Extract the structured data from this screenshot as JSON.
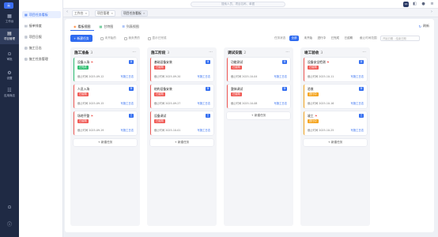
{
  "rail": {
    "logo": "云",
    "items": [
      {
        "icon": "▦",
        "label": "工作台"
      },
      {
        "icon": "▤",
        "label": "项目管理"
      },
      {
        "icon": "⊙",
        "label": "审批"
      },
      {
        "icon": "⚙",
        "label": "设置"
      },
      {
        "icon": "☷",
        "label": "应用商店"
      }
    ]
  },
  "sidebar": {
    "items": [
      {
        "label": "项目任务看板"
      },
      {
        "label": "接单排度"
      },
      {
        "label": "项目日报"
      },
      {
        "label": "施工日志"
      },
      {
        "label": "施工任务管理"
      }
    ]
  },
  "topbar": {
    "search_placeholder": "搜索人员、项目名称、单据",
    "badge": "16"
  },
  "tabs": {
    "items": [
      {
        "label": "工作台"
      },
      {
        "label": "项目管理"
      },
      {
        "label": "项目任务看板"
      }
    ]
  },
  "view": {
    "tabs": [
      {
        "label": "看板视图"
      },
      {
        "label": "甘特图"
      },
      {
        "label": "列表视图"
      }
    ],
    "refresh": "刷新"
  },
  "toolbar": {
    "new_task": "+ 新建任务",
    "checks": [
      "未开始的",
      "我负责的",
      "显示已完成"
    ],
    "status_label": "任务状态",
    "status_pills": [
      "全部",
      "未开始",
      "进行中",
      "已完成",
      "已逾期"
    ],
    "date_label": "截止时间范围",
    "date_placeholder": "开始日期 - 结束日期"
  },
  "columns": [
    {
      "title": "施工准备",
      "count": "3",
      "cards": [
        {
          "title": "设备入场",
          "flag": "⚑",
          "status": "已完成",
          "status_color": "green",
          "due": "截止时间 2025-09-12",
          "log": "写施工日志",
          "avatar": "张"
        },
        {
          "title": "人员入场",
          "flag": "",
          "status": "已逾期",
          "status_color": "red",
          "due": "截止时间 2025-09-15",
          "log": "写施工日志",
          "avatar": "李"
        },
        {
          "title": "场地平整",
          "flag": "⚑",
          "status": "已逾期",
          "status_color": "red",
          "due": "截止时间 2025-09-19",
          "log": "写施工日志",
          "avatar": "王"
        }
      ],
      "add_label": "+ 新建任务"
    },
    {
      "title": "施工阶段",
      "count": "3",
      "cards": [
        {
          "title": "基础设备安装",
          "flag": "",
          "status": "已逾期",
          "status_color": "red",
          "due": "截止时间 2025-09-20",
          "log": "写施工日志",
          "avatar": "张"
        },
        {
          "title": "结构设备安装",
          "flag": "",
          "status": "已逾期",
          "status_color": "red",
          "due": "截止时间 2025-09-27",
          "log": "写施工日志",
          "avatar": "李"
        },
        {
          "title": "设备调试",
          "flag": "",
          "status": "已逾期",
          "status_color": "red",
          "due": "截止时间 2025-10-01",
          "log": "写施工日志",
          "avatar": "王"
        }
      ],
      "add_label": "+ 新建任务"
    },
    {
      "title": "调试安装",
      "count": "2",
      "cards": [
        {
          "title": "功能测试",
          "flag": "",
          "status": "已逾期",
          "status_color": "red",
          "due": "截止时间 2025-10-04",
          "log": "写施工日志",
          "avatar": "张"
        },
        {
          "title": "整体调试",
          "flag": "",
          "status": "已逾期",
          "status_color": "red",
          "due": "截止时间 2025-10-08",
          "log": "写施工日志",
          "avatar": "李"
        }
      ],
      "add_label": "+ 新建任务"
    },
    {
      "title": "竣工验收",
      "count": "3",
      "cards": [
        {
          "title": "设备安全检测",
          "flag": "⚑",
          "status": "已逾期",
          "status_color": "red",
          "due": "截止时间 2025-10-11",
          "log": "写施工日志",
          "avatar": "张"
        },
        {
          "title": "验收",
          "flag": "",
          "status": "进行中",
          "status_color": "orange",
          "due": "截止时间 2025-10-16",
          "log": "写施工日志",
          "avatar": "李"
        },
        {
          "title": "竣工",
          "flag": "⚑",
          "status": "进行中",
          "status_color": "orange",
          "due": "截止时间 2025-10-25",
          "log": "写施工日志",
          "avatar": "王"
        }
      ],
      "add_label": "+ 新建任务"
    }
  ]
}
